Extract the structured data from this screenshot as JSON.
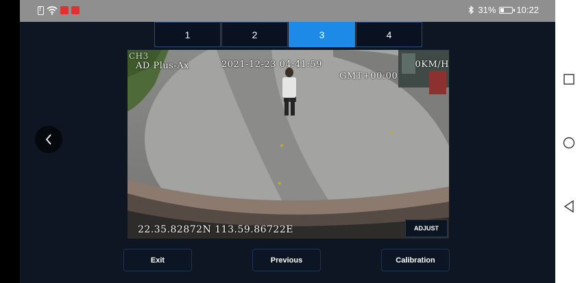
{
  "status_bar": {
    "battery_percent": "31%",
    "battery_level": 0.31,
    "time": "10:22",
    "icons": [
      "sim-alert-icon",
      "wifi-icon",
      "app-notification-icon",
      "app-notification-icon",
      "bluetooth-icon",
      "battery-icon"
    ]
  },
  "channel_tabs": [
    {
      "label": "1",
      "active": false
    },
    {
      "label": "2",
      "active": false
    },
    {
      "label": "3",
      "active": true
    },
    {
      "label": "4",
      "active": false
    }
  ],
  "video": {
    "channel_label": "CH3",
    "device_label": "AD Plus-Ax",
    "datetime": "2021-12-23 04:41:59",
    "speed": "0KM/H",
    "timezone": "GMT+00:00",
    "coordinates": "22.35.82872N 113.59.86722E",
    "adjust_label": "ADJUST"
  },
  "buttons": {
    "exit": "Exit",
    "previous": "Previous",
    "calibration": "Calibration"
  },
  "nav": {
    "icons": [
      "back-arrow-icon",
      "recent-apps-icon",
      "home-icon",
      "back-icon"
    ]
  },
  "colors": {
    "active_tab": "#1d8ae8",
    "app_background": "#0e1623",
    "status_bar": "#8f8f8f"
  }
}
